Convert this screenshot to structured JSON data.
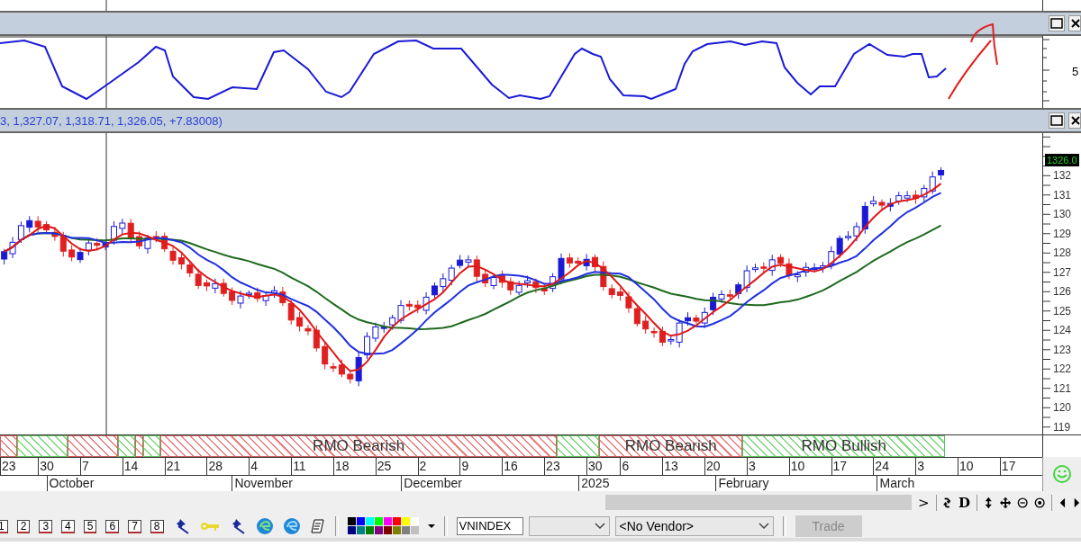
{
  "oscillator_pane": {
    "axis_label": "5"
  },
  "price_pane": {
    "header": "3, 1,327.07, 1,318.71, 1,326.05, +7.83008)",
    "last_price": "1326.0",
    "axis_labels": [
      "132",
      "131",
      "130",
      "129",
      "128",
      "127",
      "126",
      "125",
      "124",
      "123",
      "122",
      "121",
      "120",
      "119"
    ]
  },
  "rmo_bands": [
    {
      "kind": "bearish"
    },
    {
      "kind": "bullish"
    },
    {
      "kind": "bearish"
    },
    {
      "kind": "bullish"
    },
    {
      "kind": "bearish"
    },
    {
      "kind": "bullish"
    },
    {
      "kind": "bearish",
      "label": "RMO Bearish"
    },
    {
      "kind": "bullish"
    },
    {
      "kind": "bearish",
      "label": "RMO Bearish"
    },
    {
      "kind": "bullish",
      "label": "RMO Bullish"
    }
  ],
  "weeks": [
    "23",
    "30",
    "7",
    "14",
    "21",
    "28",
    "4",
    "11",
    "18",
    "25",
    "2",
    "9",
    "16",
    "23",
    "30",
    "6",
    "13",
    "20",
    "3",
    "10",
    "17",
    "24",
    "3",
    "10",
    "17"
  ],
  "months": [
    "October",
    "November",
    "December",
    "2025",
    "February",
    "March"
  ],
  "chart_nav": {
    "next": ">",
    "period": "D"
  },
  "drawing_tools": [
    "1",
    "2",
    "3",
    "4",
    "5",
    "6",
    "7",
    "8"
  ],
  "palette": [
    {
      "color": "#000000"
    },
    {
      "color": "#0000ff"
    },
    {
      "color": "#00ffff"
    },
    {
      "color": "#00ff00"
    },
    {
      "color": "#ff00ff"
    },
    {
      "color": "#ff0000"
    },
    {
      "color": "#ffff00"
    },
    {
      "color": "#ffffff"
    },
    {
      "color": "#000080"
    },
    {
      "color": "#008080"
    },
    {
      "color": "#008000"
    },
    {
      "color": "#800080"
    },
    {
      "color": "#800000"
    },
    {
      "color": "#808000"
    },
    {
      "color": "#808080"
    },
    {
      "color": "#c0c0c0"
    }
  ],
  "symbol_field": {
    "value": "VNINDEX"
  },
  "vendor_select": {
    "value": "<No Vendor>"
  },
  "trade_button": {
    "label": "Trade",
    "disabled": true
  }
}
